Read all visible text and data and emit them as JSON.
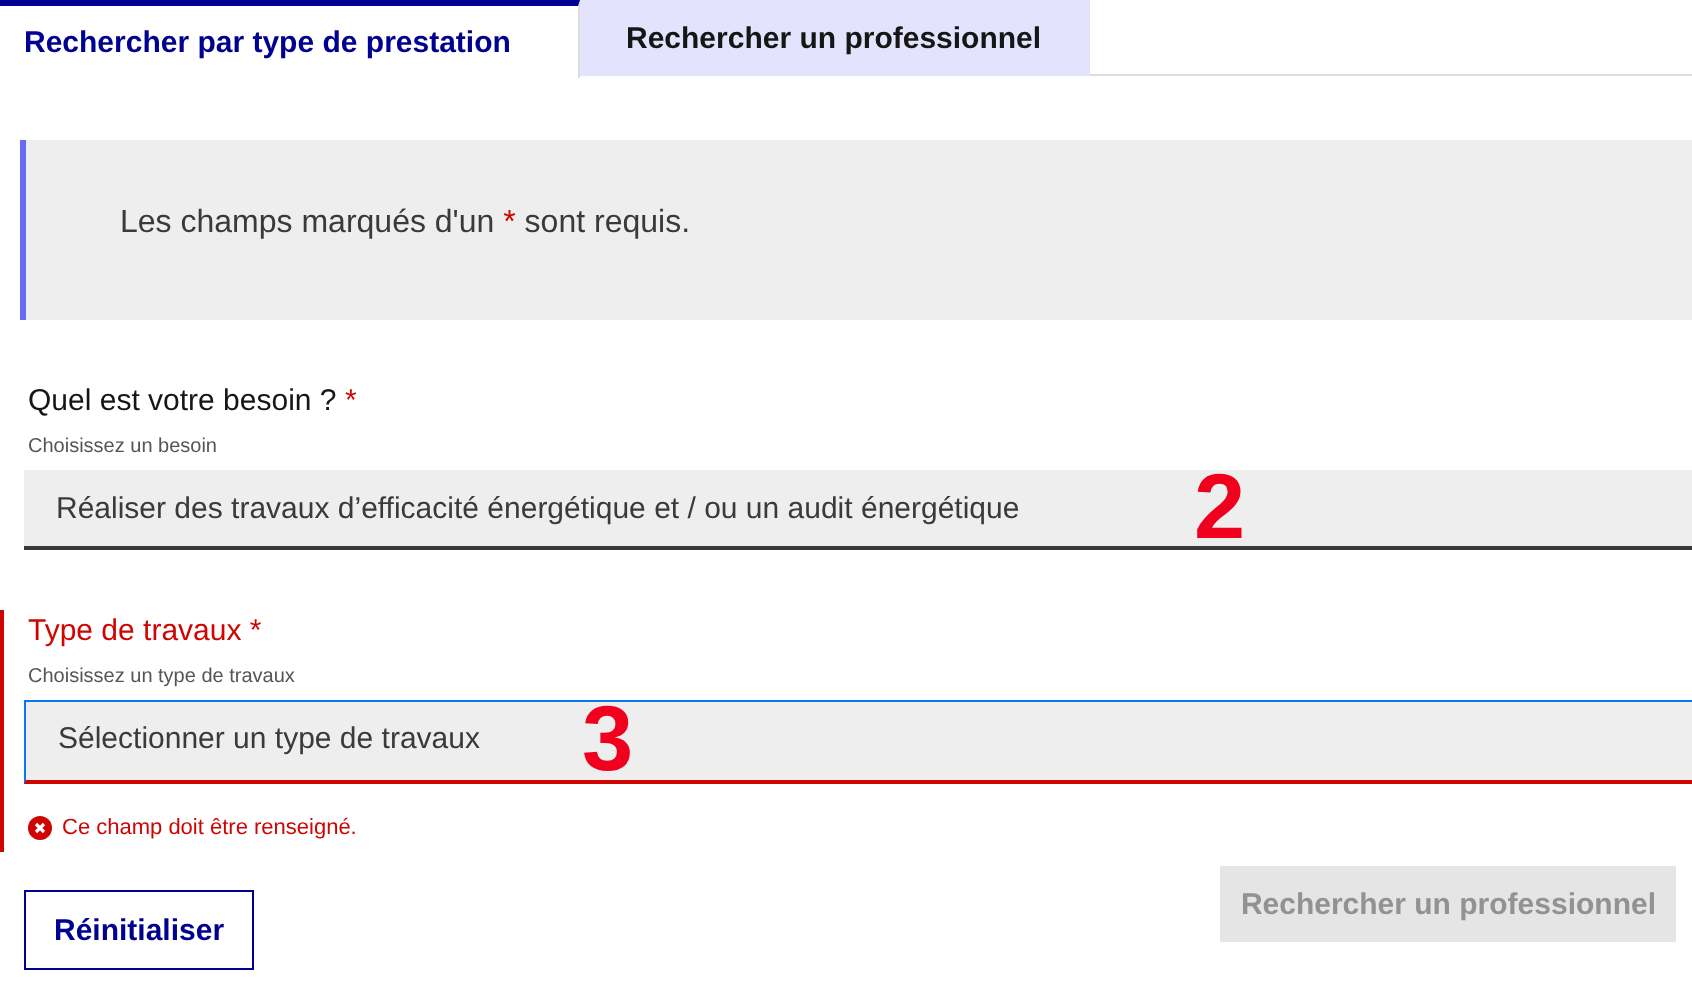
{
  "tabs": [
    {
      "label": "Rechercher par type de prestation",
      "selected": true
    },
    {
      "label": "Rechercher un professionnel",
      "selected": false
    }
  ],
  "notice": {
    "before": "Les champs marqués d'un",
    "marker": "*",
    "after": "sont requis."
  },
  "fields": [
    {
      "label": "Quel est votre besoin ?",
      "required_mark": "*",
      "hint": "Choisissez un besoin",
      "value": "Réaliser des travaux d’efficacité énergétique et / ou un audit énergétique",
      "annotation": "2",
      "invalid": false
    },
    {
      "label": "Type de travaux",
      "required_mark": "*",
      "hint": "Choisissez un type de travaux",
      "placeholder": "Sélectionner un type de travaux",
      "annotation": "3",
      "invalid": true,
      "error_message": "Ce champ doit être renseigné."
    }
  ],
  "buttons": [
    {
      "label": "Réinitialiser",
      "kind": "secondary",
      "disabled": false
    },
    {
      "label": "Rechercher un professionnel",
      "kind": "primary",
      "disabled": true
    }
  ]
}
